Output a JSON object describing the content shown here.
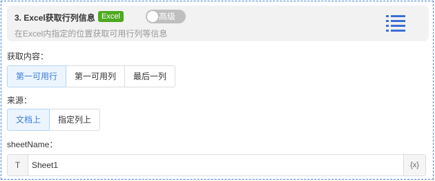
{
  "header": {
    "title": "3. Excel获取行列信息",
    "tag": "Excel",
    "toggle_label": "高级",
    "subtitle": "在Excel内指定的位置获取可用行列等信息"
  },
  "content_field": {
    "label": "获取内容：",
    "options": [
      "第一可用行",
      "第一可用列",
      "最后一列"
    ],
    "selected": "第一可用行"
  },
  "source_field": {
    "label": "来源：",
    "options": [
      "文档上",
      "指定列上"
    ],
    "selected": "文档上"
  },
  "sheet_field": {
    "label": "sheetName：",
    "prefix": "T",
    "value": "Sheet1",
    "suffix": "{x}"
  },
  "colors": {
    "accent": "#3b7dd8",
    "tag": "#4caa1f",
    "border_dashed": "#3f7fd9"
  }
}
